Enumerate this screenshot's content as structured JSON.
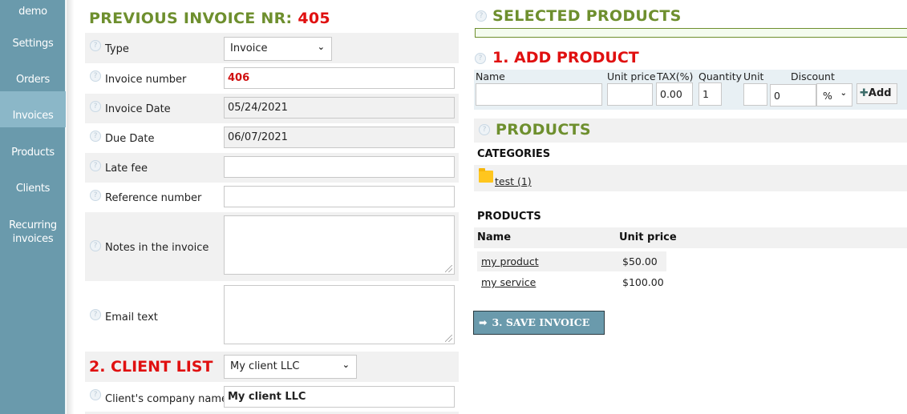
{
  "sidebar": {
    "items": [
      {
        "label": "demo"
      },
      {
        "label": "Settings"
      },
      {
        "label": "Orders"
      },
      {
        "label": "Invoices",
        "active": true
      },
      {
        "label": "Products"
      },
      {
        "label": "Clients"
      },
      {
        "label": "Recurring invoices"
      }
    ]
  },
  "form": {
    "title_prefix": "PREVIOUS INVOICE NR:",
    "previous_number": "405",
    "fields": {
      "type": {
        "label": "Type",
        "value": "Invoice"
      },
      "invoice_number": {
        "label": "Invoice number",
        "value": "406"
      },
      "invoice_date": {
        "label": "Invoice Date",
        "value": "05/24/2021"
      },
      "due_date": {
        "label": "Due Date",
        "value": "06/07/2021"
      },
      "late_fee": {
        "label": "Late fee",
        "value": ""
      },
      "reference_number": {
        "label": "Reference number",
        "value": ""
      },
      "notes": {
        "label": "Notes in the invoice",
        "value": ""
      },
      "email_text": {
        "label": "Email text",
        "value": ""
      },
      "client_company": {
        "label": "Client's company name",
        "value": "My client LLC"
      }
    },
    "client_list": {
      "title": "2. CLIENT LIST",
      "selected": "My client LLC"
    }
  },
  "selected_products": {
    "title": "SELECTED PRODUCTS"
  },
  "add_product": {
    "title": "1. ADD PRODUCT",
    "columns": {
      "name": "Name",
      "unit_price": "Unit price",
      "tax": "TAX(%)",
      "quantity": "Quantity",
      "unit": "Unit",
      "discount": "Discount"
    },
    "values": {
      "name": "",
      "unit_price": "",
      "tax": "0.00",
      "quantity": "1",
      "unit": "",
      "discount": "0",
      "discount_type": "%"
    },
    "add_label": "Add"
  },
  "products": {
    "title": "PRODUCTS",
    "categories_label": "CATEGORIES",
    "categories": [
      {
        "label": "test (1)"
      }
    ],
    "products_label": "PRODUCTS",
    "table_headers": {
      "name": "Name",
      "unit_price": "Unit price"
    },
    "rows": [
      {
        "name": "my product",
        "price": "$50.00"
      },
      {
        "name": "my service",
        "price": "$100.00"
      }
    ]
  },
  "save_button": {
    "label": "3. SAVE INVOICE"
  },
  "colors": {
    "sidebar": "#6a9aac",
    "sidebar_active": "#8bb7c8",
    "heading_green": "#6e8f2e",
    "heading_red": "#e01010"
  }
}
